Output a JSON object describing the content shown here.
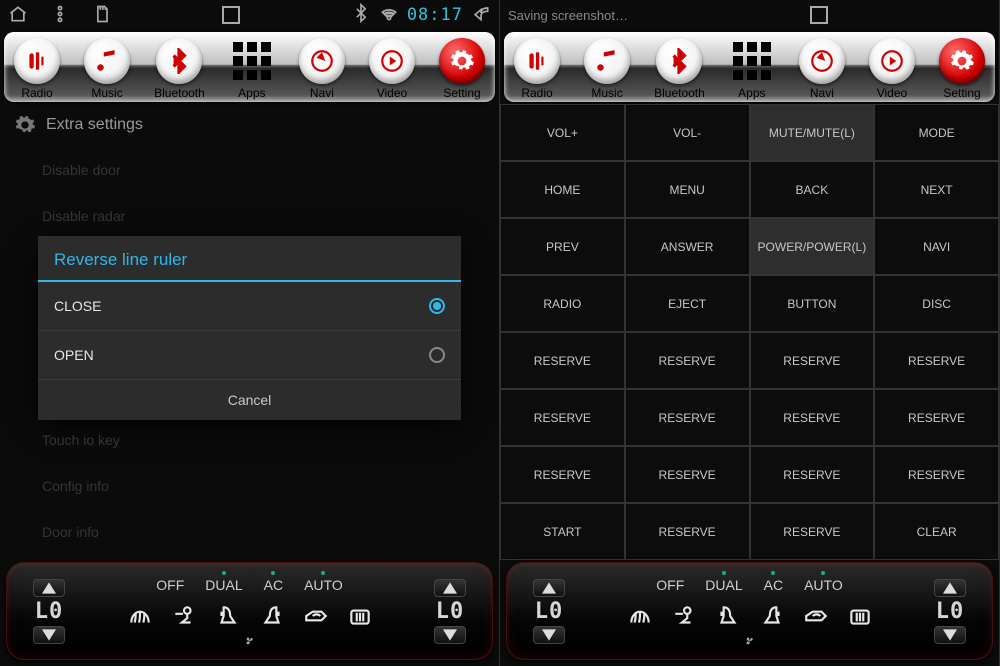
{
  "status_left": {
    "time": "08:17"
  },
  "status_right": {
    "title": "Saving screenshot…",
    "time": ""
  },
  "toolbar": [
    {
      "label": "Radio"
    },
    {
      "label": "Music"
    },
    {
      "label": "Bluetooth"
    },
    {
      "label": "Apps"
    },
    {
      "label": "Navi"
    },
    {
      "label": "Video"
    },
    {
      "label": "Setting"
    }
  ],
  "left_panel": {
    "title": "Extra settings",
    "items": [
      "Disable door",
      "Disable radar",
      "Touch io key",
      "Config info",
      "Door info"
    ],
    "dialog": {
      "title": "Reverse line ruler",
      "options": [
        {
          "label": "CLOSE",
          "selected": true
        },
        {
          "label": "OPEN",
          "selected": false
        }
      ],
      "cancel": "Cancel"
    }
  },
  "right_panel": {
    "keys": [
      {
        "label": "VOL+"
      },
      {
        "label": "VOL-"
      },
      {
        "label": "MUTE/MUTE(L)",
        "active": true
      },
      {
        "label": "MODE"
      },
      {
        "label": "HOME"
      },
      {
        "label": "MENU"
      },
      {
        "label": "BACK"
      },
      {
        "label": "NEXT"
      },
      {
        "label": "PREV"
      },
      {
        "label": "ANSWER"
      },
      {
        "label": "POWER/POWER(L)",
        "active": true
      },
      {
        "label": "NAVI"
      },
      {
        "label": "RADIO"
      },
      {
        "label": "EJECT"
      },
      {
        "label": "BUTTON"
      },
      {
        "label": "DISC"
      },
      {
        "label": "RESERVE"
      },
      {
        "label": "RESERVE"
      },
      {
        "label": "RESERVE"
      },
      {
        "label": "RESERVE"
      },
      {
        "label": "RESERVE"
      },
      {
        "label": "RESERVE"
      },
      {
        "label": "RESERVE"
      },
      {
        "label": "RESERVE"
      },
      {
        "label": "RESERVE"
      },
      {
        "label": "RESERVE"
      },
      {
        "label": "RESERVE"
      },
      {
        "label": "RESERVE"
      },
      {
        "label": "START"
      },
      {
        "label": "RESERVE"
      },
      {
        "label": "RESERVE"
      },
      {
        "label": "CLEAR"
      }
    ]
  },
  "climate": {
    "temp_left": "L0",
    "temp_right": "L0",
    "modes": [
      "OFF",
      "DUAL",
      "AC",
      "AUTO"
    ]
  }
}
